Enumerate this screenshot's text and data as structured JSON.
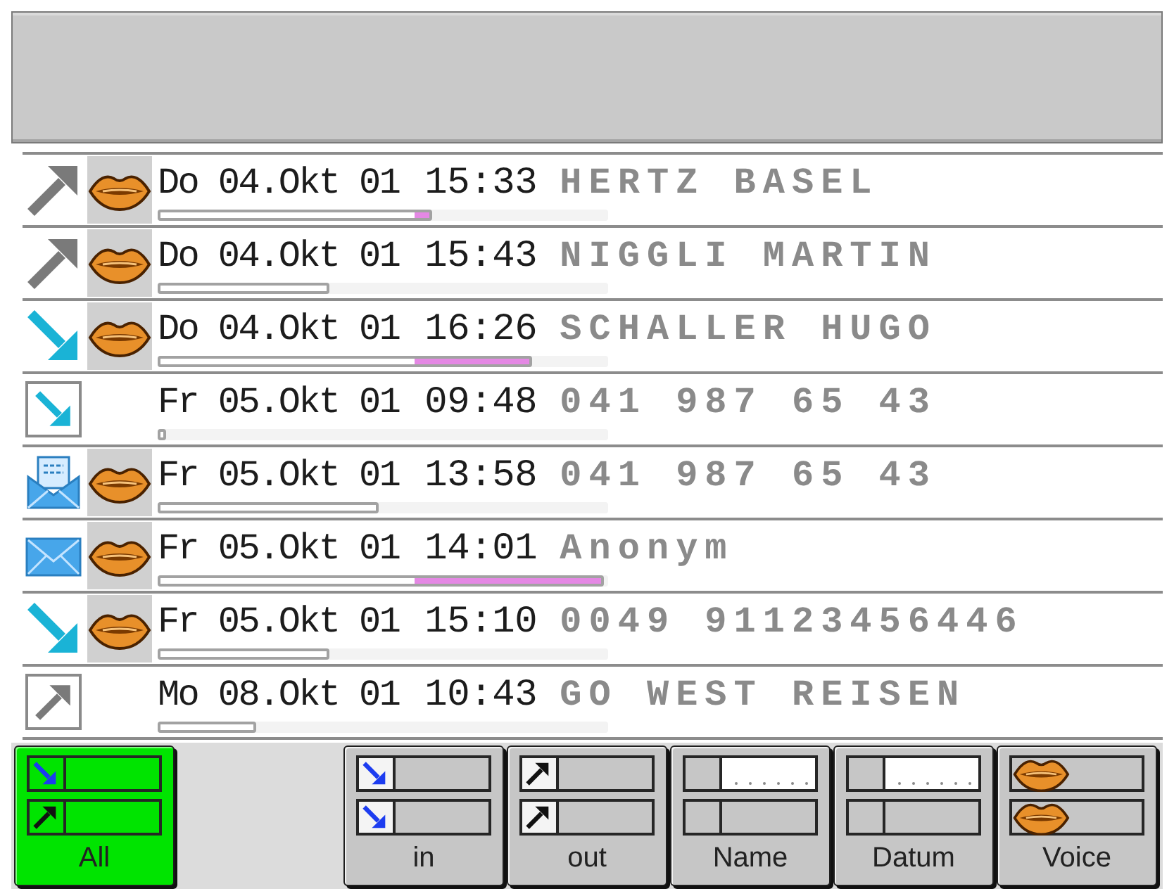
{
  "calls": [
    {
      "kind": "out",
      "framed": false,
      "voice": true,
      "date": "Do 04.Okt 01",
      "time": "15:33",
      "name": "HERTZ BASEL",
      "level": 0.61
    },
    {
      "kind": "out",
      "framed": false,
      "voice": true,
      "date": "Do 04.Okt 01",
      "time": "15:43",
      "name": "NIGGLI MARTIN",
      "level": 0.38
    },
    {
      "kind": "in",
      "framed": false,
      "voice": true,
      "date": "Do 04.Okt 01",
      "time": "16:26",
      "name": "SCHALLER HUGO",
      "level": 0.83
    },
    {
      "kind": "in",
      "framed": true,
      "voice": false,
      "date": "Fr 05.Okt 01",
      "time": "09:48",
      "name": "041 987 65 43",
      "level": 0.02
    },
    {
      "kind": "letter",
      "framed": false,
      "voice": true,
      "date": "Fr 05.Okt 01",
      "time": "13:58",
      "name": "041 987 65 43",
      "level": 0.49
    },
    {
      "kind": "mail",
      "framed": false,
      "voice": true,
      "date": "Fr 05.Okt 01",
      "time": "14:01",
      "name": "Anonym",
      "level": 0.99
    },
    {
      "kind": "in",
      "framed": false,
      "voice": true,
      "date": "Fr 05.Okt 01",
      "time": "15:10",
      "name": "0049 91123456446",
      "level": 0.38
    },
    {
      "kind": "out",
      "framed": true,
      "voice": false,
      "date": "Mo 08.Okt 01",
      "time": "10:43",
      "name": "GO WEST REISEN",
      "level": 0.22
    }
  ],
  "filters": [
    {
      "kind": "all",
      "label": "All",
      "selected": true
    },
    {
      "kind": "in",
      "label": "in",
      "selected": false
    },
    {
      "kind": "out",
      "label": "out",
      "selected": false
    },
    {
      "kind": "name",
      "label": "Name",
      "selected": false
    },
    {
      "kind": "date",
      "label": "Datum",
      "selected": false
    },
    {
      "kind": "voice",
      "label": "Voice",
      "selected": false
    }
  ]
}
